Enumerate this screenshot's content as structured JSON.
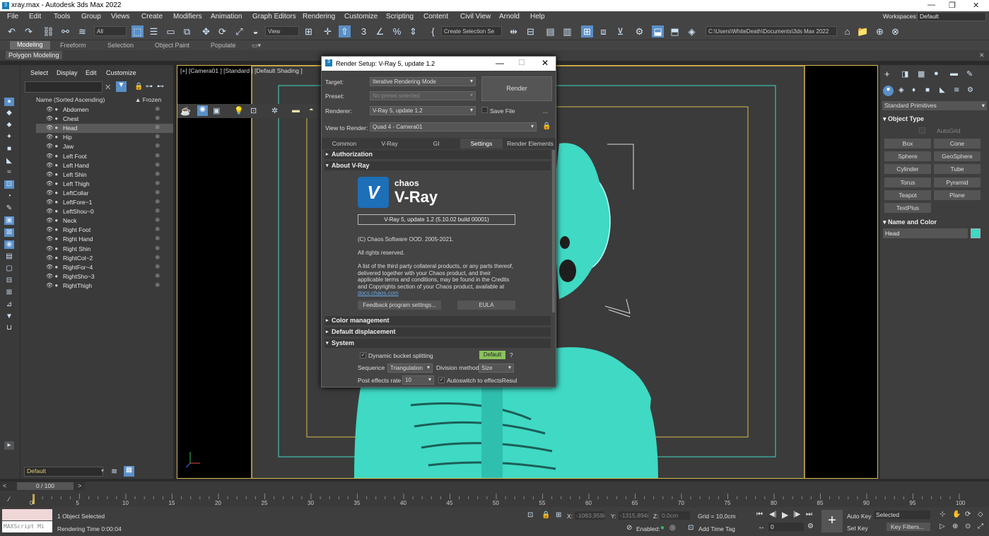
{
  "window": {
    "title": "xray.max - Autodesk 3ds Max 2022"
  },
  "menu": [
    "File",
    "Edit",
    "Tools",
    "Group",
    "Views",
    "Create",
    "Modifiers",
    "Animation",
    "Graph Editors",
    "Rendering",
    "Customize",
    "Scripting",
    "Content",
    "Civil View",
    "Arnold",
    "Help"
  ],
  "workspaces": {
    "label": "Workspaces:",
    "value": "Default"
  },
  "toolbar": {
    "filter": "All",
    "refcoord": "View",
    "selset": "Create Selection Se",
    "path": "C:\\Users\\WhiteDeath\\Documents\\3ds Max 2022"
  },
  "ribbon": {
    "tabs": [
      "Modeling",
      "Freeform",
      "Selection",
      "Object Paint",
      "Populate"
    ],
    "sub": "Polygon Modeling"
  },
  "explorer": {
    "tabs": [
      "Select",
      "Display",
      "Edit",
      "Customize"
    ],
    "header": "Name (Sorted Ascending)",
    "frozen": "▲ Frozen",
    "objects": [
      "Abdomen",
      "Chest",
      "Head",
      "Hip",
      "Jaw",
      "Left Foot",
      "Left Hand",
      "Left Shin",
      "Left Thigh",
      "LeftCollar",
      "LeftFore~1",
      "LeftShou~0",
      "Neck",
      "Right Foot",
      "Right Hand",
      "Right Shin",
      "RightCol~2",
      "RightFor~4",
      "RightSho~3",
      "RightThigh"
    ],
    "selected": "Head",
    "layer": "Default"
  },
  "viewport": {
    "label": "[+] [Camera01 ] [Standard ] [Default Shading ]"
  },
  "render_setup": {
    "title": "Render Setup: V-Ray 5, update 1.2",
    "target_label": "Target:",
    "target": "Iterative Rendering Mode",
    "preset_label": "Preset:",
    "preset": "No preset selected",
    "renderer_label": "Renderer:",
    "renderer": "V-Ray 5, update 1.2",
    "save_file": "Save File",
    "dots": "...",
    "view_label": "View to Render:",
    "view": "Quad 4 - Camera01",
    "render_button": "Render",
    "tabs": [
      "Common",
      "V-Ray",
      "GI",
      "Settings",
      "Render Elements"
    ],
    "active_tab": "Settings",
    "rollouts": {
      "authorization": "Authorization",
      "about": "About V-Ray",
      "color": "Color management",
      "displacement": "Default displacement",
      "system": "System"
    },
    "logo_top": "chaos",
    "logo_main": "V-Ray",
    "version": "V-Ray 5, update 1.2 (5.10.02 build 00001)",
    "copyright": "(C) Chaos Software OOD. 2005-2021.",
    "rights": "All rights reserved.",
    "notice": "A list of the third party collateral products, or any parts thereof, delivered together with your Chaos product, and their applicable terms and conditions, may be found in the Credits and Copyrights section of your Chaos product, available at",
    "link": "docs.chaos.com",
    "feedback": "Feedback program settings...",
    "eula": "EULA",
    "dyn_bucket": "Dynamic bucket splitting",
    "default_btn": "Default",
    "help": "?",
    "sequence_label": "Sequence",
    "sequence": "Triangulation",
    "division_label": "Division method",
    "division": "Size",
    "post_label": "Post effects rate",
    "post": "10",
    "autoswitch": "Autoswitch to effectsResul"
  },
  "command_panel": {
    "category": "Standard Primitives",
    "object_type": "Object Type",
    "autogrid": "AutoGrid",
    "buttons": [
      "Box",
      "Cone",
      "Sphere",
      "GeoSphere",
      "Cylinder",
      "Tube",
      "Torus",
      "Pyramid",
      "Teapot",
      "Plane",
      "TextPlus"
    ],
    "name_color": "Name and Color",
    "name": "Head",
    "color": "#3fd9c4"
  },
  "timeline": {
    "frame": "0 / 100",
    "ticks": [
      "0",
      "5",
      "10",
      "15",
      "20",
      "25",
      "30",
      "35",
      "40",
      "45",
      "50",
      "55",
      "60",
      "65",
      "70",
      "75",
      "80",
      "85",
      "90",
      "95",
      "100"
    ]
  },
  "status": {
    "selected": "1 Object Selected",
    "render_time": "Rendering Time  0:00:04",
    "maxscript": "MAXScript Mi",
    "x_label": "X:",
    "x": "-1083,959i",
    "y_label": "Y:",
    "y": "-1315,894i",
    "z_label": "Z:",
    "z": "0,0cm",
    "grid": "Grid = 10,0cm",
    "enabled": "Enabled:",
    "add_time_tag": "Add Time Tag",
    "auto_key": "Auto Key",
    "set_key": "Set Key",
    "key_sel": "Selected",
    "key_filters": "Key Filters...",
    "frame_field": "0"
  },
  "colors": {
    "skeleton": "#3fd9c4",
    "accent": "#5a8fc7",
    "frame": "#d9b84a"
  }
}
